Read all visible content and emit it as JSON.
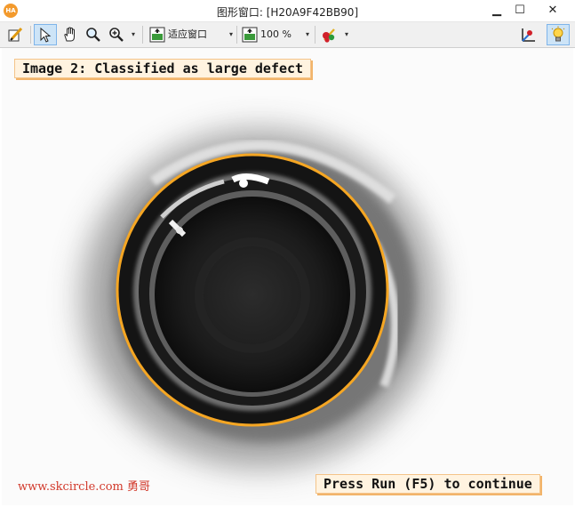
{
  "window": {
    "title": "图形窗口: [H20A9F42BB90]",
    "logo_text": "HA",
    "minimize": "▁",
    "maximize": "☐",
    "close": "✕"
  },
  "toolbar": {
    "fit_window_label": "适应窗口",
    "zoom_label": "100 %",
    "dropdown_glyph": "▾"
  },
  "canvas": {
    "top_message": "Image 2: Classified as large defect",
    "bottom_message": "Press Run (F5) to continue",
    "watermark": "www.skcircle.com 勇哥"
  },
  "colors": {
    "highlight_circle": "#f5a623",
    "overlay_fill": "#fff3e0",
    "watermark": "#d23a2c"
  }
}
